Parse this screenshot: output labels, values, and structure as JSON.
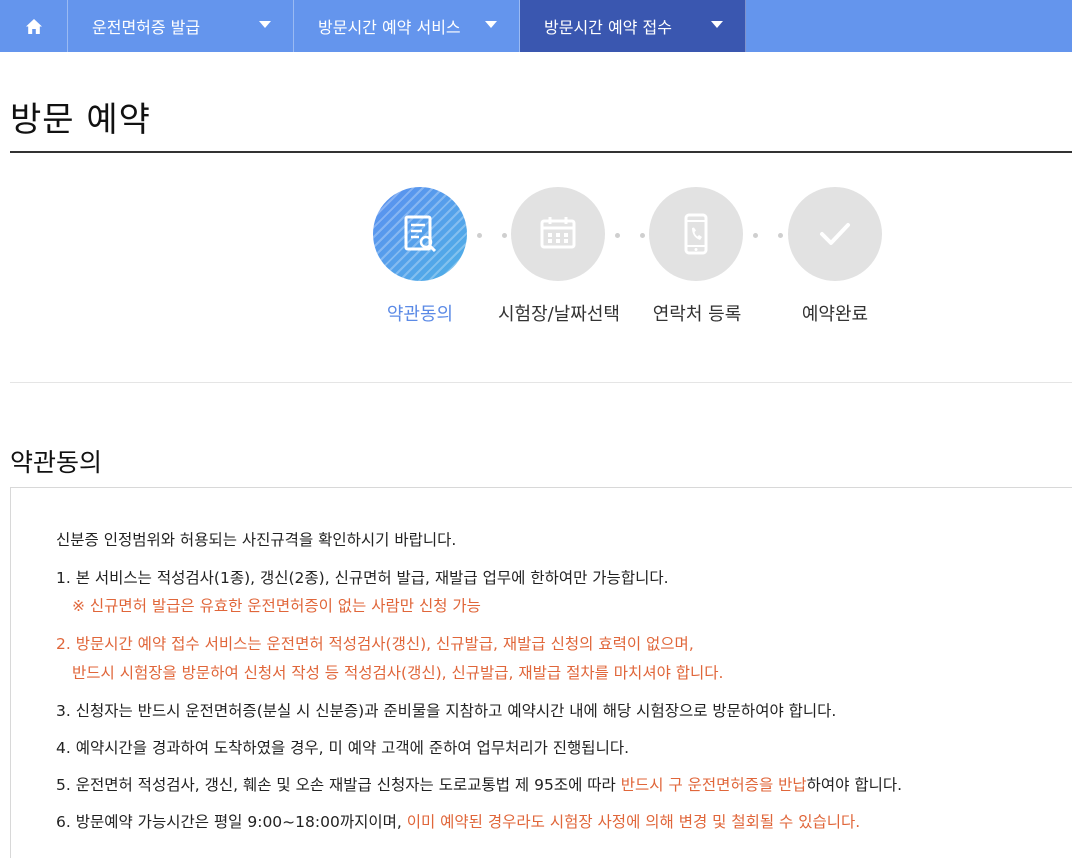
{
  "nav": {
    "home_icon": "home-icon",
    "items": [
      {
        "label": "운전면허증 발급"
      },
      {
        "label": "방문시간 예약 서비스"
      },
      {
        "label": "방문시간 예약 접수"
      }
    ]
  },
  "page": {
    "title": "방문 예약"
  },
  "steps": [
    {
      "label": "약관동의",
      "icon": "document-search-icon",
      "active": true
    },
    {
      "label": "시험장/날짜선택",
      "icon": "calendar-icon",
      "active": false
    },
    {
      "label": "연락처 등록",
      "icon": "phone-icon",
      "active": false
    },
    {
      "label": "예약완료",
      "icon": "check-icon",
      "active": false
    }
  ],
  "section": {
    "title": "약관동의"
  },
  "terms": {
    "intro": "신분증 인정범위와 허용되는 사진규격을 확인하시기 바랍니다.",
    "t1": "1. 본 서비스는 적성검사(1종), 갱신(2종), 신규면허 발급, 재발급 업무에 한하여만 가능합니다.",
    "t1_note": "※ 신규면허 발급은 유효한 운전면허증이 없는 사람만 신청 가능",
    "t2_a": "2. 방문시간 예약 접수 서비스는 운전면허 적성검사(갱신), 신규발급, 재발급 신청의 효력이 없으며,",
    "t2_b": "반드시 시험장을 방문하여 신청서 작성 등 적성검사(갱신), 신규발급, 재발급 절차를 마치셔야 합니다.",
    "t3": "3. 신청자는 반드시 운전면허증(분실 시 신분증)과 준비물을 지참하고 예약시간 내에 해당 시험장으로 방문하여야 합니다.",
    "t4": "4. 예약시간을 경과하여 도착하였을 경우, 미 예약 고객에 준하여 업무처리가 진행됩니다.",
    "t5_pre": "5. 운전면허 적성검사, 갱신, 훼손 및 오손 재발급 신청자는 도로교통법 제 95조에 따라 ",
    "t5_red": "반드시 구 운전면허증을 반납",
    "t5_post": "하여야 합니다.",
    "t6_pre": "6. 방문예약 가능시간은 평일 9:00~18:00까지이며, ",
    "t6_red": "이미 예약된 경우라도 시험장 사정에 의해 변경 및 철회될 수 있습니다."
  },
  "colors": {
    "nav_bg": "#6495ed",
    "nav_active": "#3a57b0",
    "step_active": "#5b8ae6",
    "step_inactive": "#e2e2e2",
    "warning": "#e0663a"
  }
}
